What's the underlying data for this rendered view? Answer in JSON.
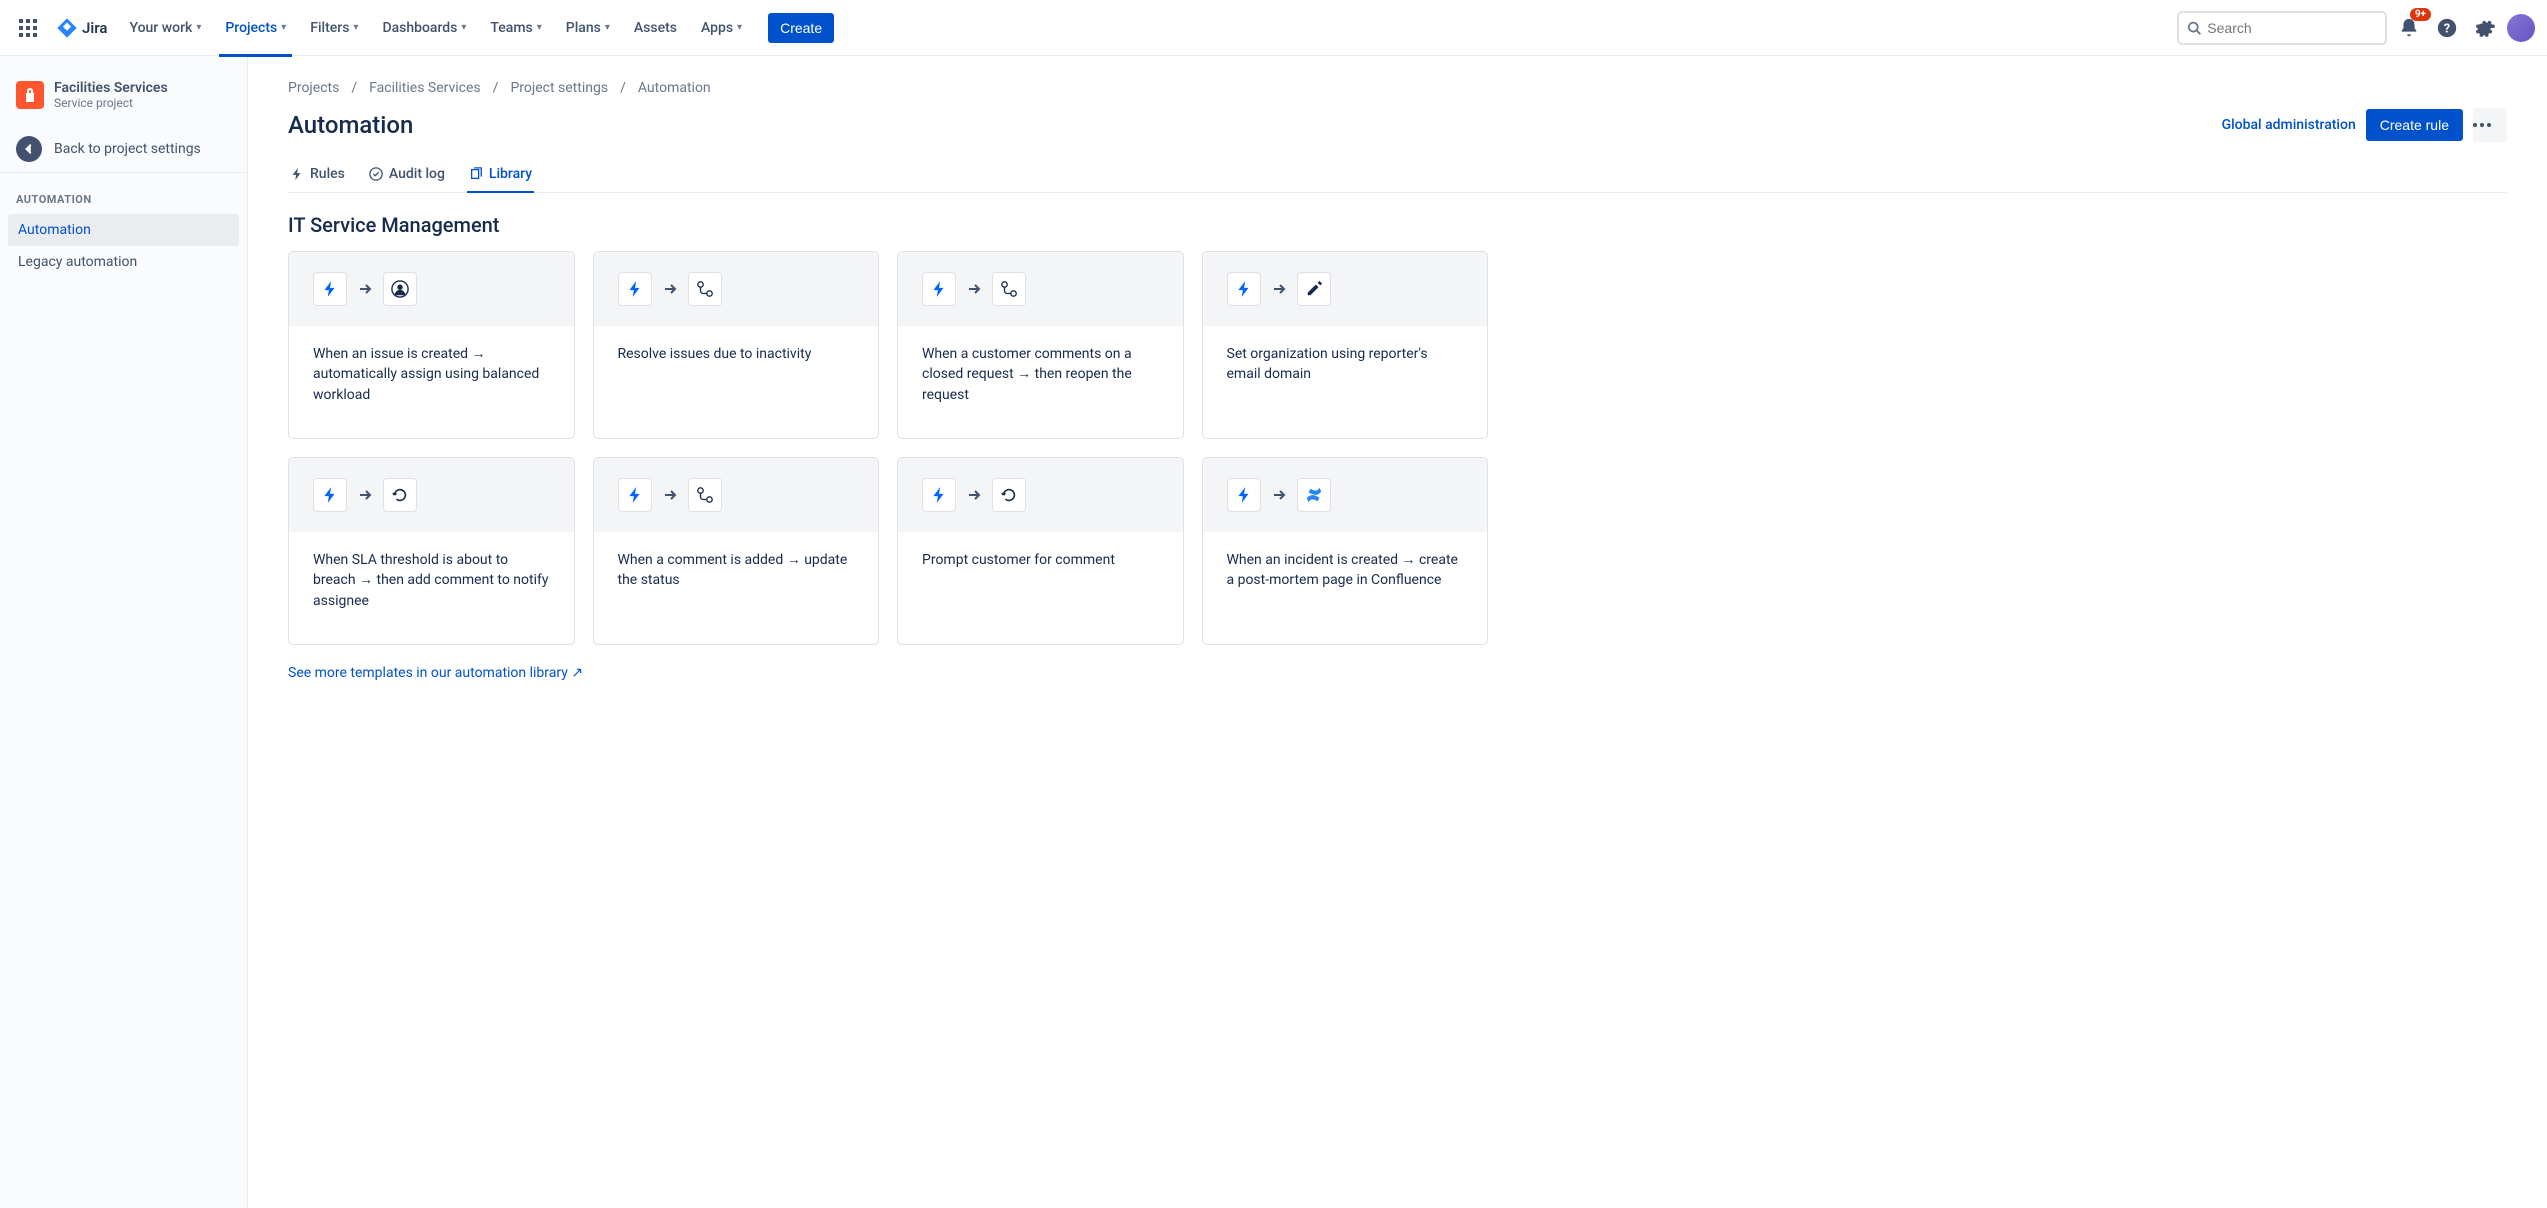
{
  "nav": {
    "logo": "Jira",
    "items": [
      "Your work",
      "Projects",
      "Filters",
      "Dashboards",
      "Teams",
      "Plans",
      "Assets",
      "Apps"
    ],
    "create": "Create",
    "search_placeholder": "Search",
    "badge": "9+"
  },
  "sidebar": {
    "project_name": "Facilities Services",
    "project_type": "Service project",
    "back": "Back to project settings",
    "heading": "AUTOMATION",
    "items": [
      "Automation",
      "Legacy automation"
    ]
  },
  "breadcrumb": [
    "Projects",
    "Facilities Services",
    "Project settings",
    "Automation"
  ],
  "page": {
    "title": "Automation",
    "global_admin": "Global administration",
    "create_rule": "Create rule"
  },
  "tabs": [
    "Rules",
    "Audit log",
    "Library"
  ],
  "section": "IT Service Management",
  "cards": [
    {
      "text": "When an issue is created → automatically assign using balanced workload",
      "icon": "user"
    },
    {
      "text": "Resolve issues due to inactivity",
      "icon": "flow"
    },
    {
      "text": "When a customer comments on a closed request → then reopen the request",
      "icon": "flow"
    },
    {
      "text": "Set organization using reporter's email domain",
      "icon": "edit"
    },
    {
      "text": "When SLA threshold is about to breach → then add comment to notify assignee",
      "icon": "refresh"
    },
    {
      "text": "When a comment is added → update the status",
      "icon": "flow"
    },
    {
      "text": "Prompt customer for comment",
      "icon": "refresh"
    },
    {
      "text": "When an incident is created → create a post-mortem page in Confluence",
      "icon": "confluence"
    }
  ],
  "see_more": "See more templates in our automation library ↗"
}
